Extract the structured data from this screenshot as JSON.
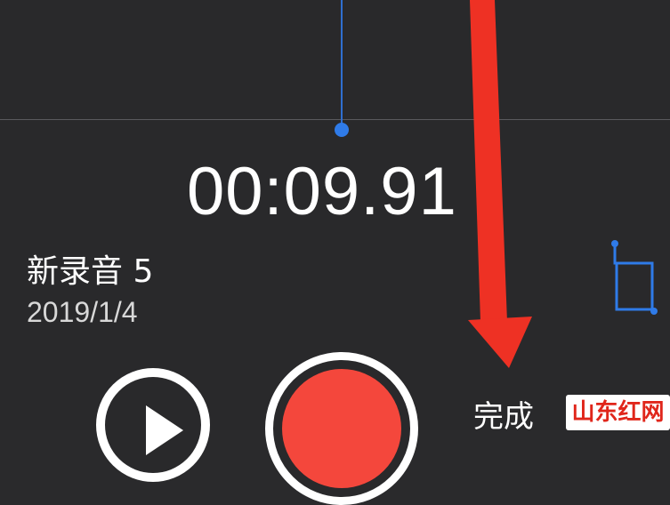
{
  "timer": {
    "elapsed": "00:09.91"
  },
  "recording": {
    "title": "新录音 5",
    "date": "2019/1/4"
  },
  "controls": {
    "done_label": "完成"
  },
  "watermark": {
    "text": "山东红网"
  },
  "icons": {
    "play": "play-icon",
    "record": "record-icon",
    "crop": "crop-icon"
  },
  "colors": {
    "background": "#29292b",
    "accent_blue": "#2f7be8",
    "record_red": "#f4473c",
    "annotation_arrow": "#ee3124"
  }
}
